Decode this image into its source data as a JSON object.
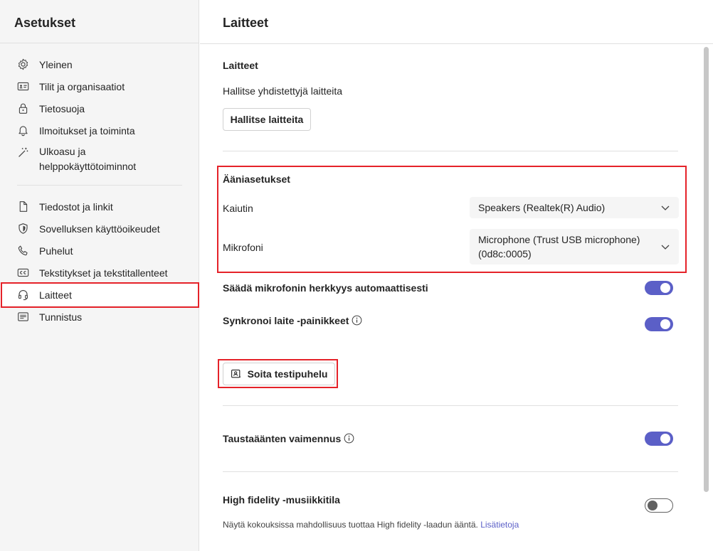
{
  "sidebar": {
    "title": "Asetukset",
    "items": [
      {
        "label": "Yleinen",
        "icon": "gear-icon"
      },
      {
        "label": "Tilit ja organisaatiot",
        "icon": "id-card-icon"
      },
      {
        "label": "Tietosuoja",
        "icon": "lock-icon"
      },
      {
        "label": "Ilmoitukset ja toiminta",
        "icon": "bell-icon"
      },
      {
        "label": "Ulkoasu ja\nhelppokäyttötoiminnot",
        "icon": "magic-wand-icon"
      },
      {
        "label": "Tiedostot ja linkit",
        "icon": "document-icon"
      },
      {
        "label": "Sovelluksen käyttöoikeudet",
        "icon": "shield-icon"
      },
      {
        "label": "Puhelut",
        "icon": "phone-icon"
      },
      {
        "label": "Tekstitykset ja tekstitallenteet",
        "icon": "closed-captions-icon"
      },
      {
        "label": "Laitteet",
        "icon": "headset-icon"
      },
      {
        "label": "Tunnistus",
        "icon": "list-icon"
      }
    ]
  },
  "main": {
    "title": "Laitteet",
    "devices_section": {
      "title": "Laitteet",
      "description": "Hallitse yhdistettyjä laitteita",
      "manage_button": "Hallitse laitteita"
    },
    "audio_section": {
      "title": "Ääniasetukset",
      "speaker_label": "Kaiutin",
      "speaker_value": "Speakers (Realtek(R) Audio)",
      "mic_label": "Mikrofoni",
      "mic_value": "Microphone (Trust USB microphone) (0d8c:0005)"
    },
    "auto_mic": {
      "label": "Säädä mikrofonin herkkyys automaattisesti",
      "enabled": true
    },
    "sync_buttons": {
      "label": "Synkronoi laite -painikkeet",
      "enabled": true
    },
    "test_call_button": "Soita testipuhelu",
    "noise_suppression": {
      "label": "Taustaäänten vaimennus",
      "enabled": true
    },
    "hifi_music": {
      "label": "High fidelity -musiikkitila",
      "enabled": false,
      "description": "Näytä kokouksissa mahdollisuus tuottaa High fidelity -laadun ääntä.",
      "link": "Lisätietoja"
    }
  },
  "colors": {
    "accent": "#5b5fc7",
    "highlight_box": "#e52229"
  }
}
